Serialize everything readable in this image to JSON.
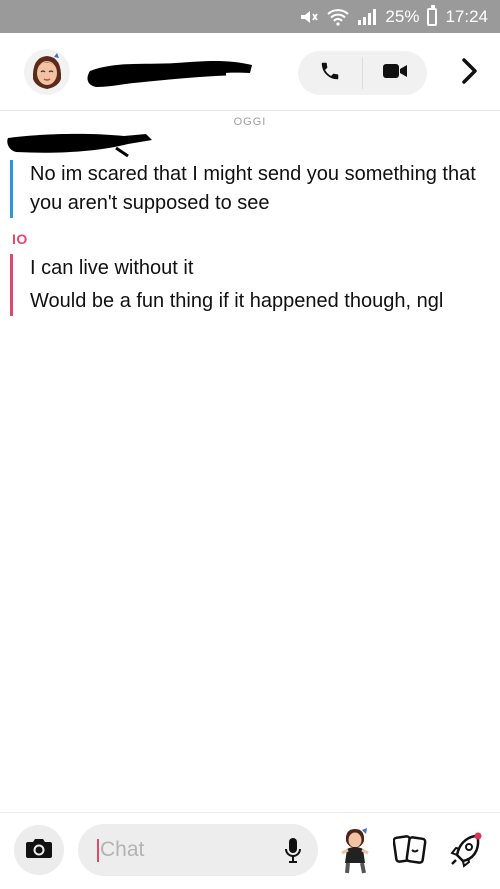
{
  "status_bar": {
    "battery": "25%",
    "time": "17:24",
    "icons": [
      "mute-icon",
      "wifi-icon",
      "signal-icon",
      "battery-icon"
    ]
  },
  "header": {
    "contact_name_redacted": true,
    "call_icon": "phone-icon",
    "video_icon": "video-camera-icon",
    "more_icon": "chevron-right-icon"
  },
  "conversation": {
    "date_label": "OGGI",
    "friend": {
      "sender_redacted": true,
      "color": "#2d98d6",
      "messages": [
        "No im scared that I might send you something that you aren't supposed to see"
      ]
    },
    "me": {
      "label": "IO",
      "color": "#e04a6a",
      "messages": [
        "I can live without it",
        "Would be a fun thing if it happened though, ngl"
      ]
    }
  },
  "bottom_bar": {
    "chat_placeholder": "Chat",
    "icons": [
      "camera-icon",
      "microphone-icon",
      "bitmoji-icon",
      "cards-icon",
      "rocket-icon"
    ]
  }
}
